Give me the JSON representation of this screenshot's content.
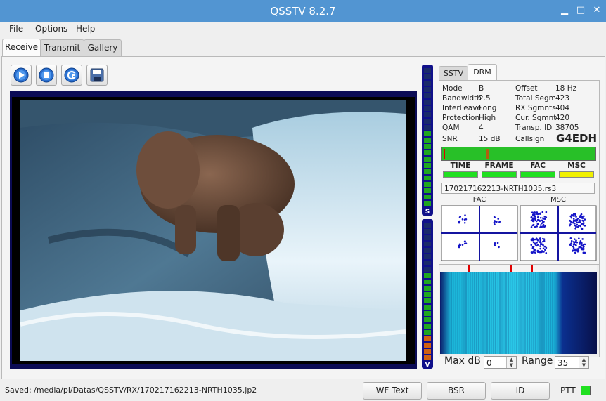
{
  "window": {
    "title": "QSSTV 8.2.7",
    "minimize": "▁",
    "maximize": "□",
    "close": "✕"
  },
  "menu": [
    "File",
    "Options",
    "Help"
  ],
  "tabs": [
    "Receive",
    "Transmit",
    "Gallery"
  ],
  "toolbar": {
    "icons": [
      "play-icon",
      "stop-icon",
      "reset-icon",
      "save-icon"
    ]
  },
  "side_tabs": [
    "SSTV",
    "DRM"
  ],
  "drm": {
    "left_labels": [
      "Mode",
      "Bandwidth",
      "InterLeave",
      "Protection",
      "QAM",
      "SNR"
    ],
    "left_values": [
      "B",
      "2.5",
      "Long",
      "High",
      "4",
      "15 dB"
    ],
    "right_labels": [
      "Offset",
      "Total Segm.",
      "RX  Sgmnts",
      "Cur. Sgmnt",
      "Transp. ID",
      "Callsign"
    ],
    "right_values": [
      "18 Hz",
      "423",
      "404",
      "420",
      "38705",
      "G4EDH"
    ],
    "states": [
      "TIME",
      "FRAME",
      "FAC",
      "MSC"
    ],
    "state_colors": [
      "#20e020",
      "#20e020",
      "#20e020",
      "#f0f000"
    ],
    "filename": "170217162213-NRTH1035.rs3",
    "fac_label": "FAC",
    "msc_label": "MSC"
  },
  "vu": {
    "top_label": "S",
    "bottom_label": "V"
  },
  "waterfall": {
    "maxdb_label": "Max dB",
    "maxdb_value": "0",
    "range_label": "Range",
    "range_value": "35"
  },
  "status": {
    "saved_text": "Saved: /media/pi/Datas/QSSTV/RX/170217162213-NRTH1035.jp2",
    "wf_text": "WF Text",
    "bsr": "BSR",
    "id": "ID",
    "ptt": "PTT",
    "ptt_color": "#20e020"
  }
}
